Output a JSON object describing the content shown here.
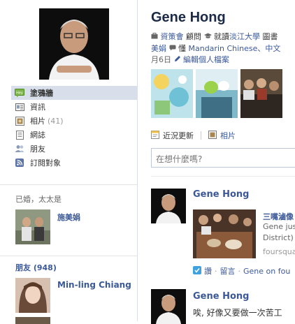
{
  "profile": {
    "name": "Gene Hong",
    "work_org": "資策會",
    "work_role": " 顧問 ",
    "school_prefix": " 就讀",
    "school_name": "淡江大學",
    "school_suffix": " 圖書",
    "spouse_fragment": "美娟",
    "languages_prefix": " 懂 ",
    "languages": "Mandarin Chinese、中文",
    "birthday_fragment": "月6日",
    "edit_profile_label": "編輯個人檔案"
  },
  "nav": {
    "items": [
      {
        "label": "塗鴉牆",
        "icon": "wall-icon",
        "active": true
      },
      {
        "label": "資訊",
        "icon": "info-icon"
      },
      {
        "label": "相片",
        "icon": "photos-icon",
        "count": "(41)"
      },
      {
        "label": "網誌",
        "icon": "notes-icon"
      },
      {
        "label": "朋友",
        "icon": "friends-icon"
      },
      {
        "label": "訂閱對象",
        "icon": "subscriptions-icon"
      }
    ]
  },
  "relationship": {
    "label": "已婚，太太是",
    "partner_name": "施美娟"
  },
  "friends": {
    "title": "朋友 (948)",
    "first_friend": "Min-ling Chiang"
  },
  "publisher": {
    "status_tab": "近況更新",
    "photo_tab": "相片",
    "placeholder": "在想什麼嗎?"
  },
  "feed": {
    "story1": {
      "author": "Gene Hong",
      "attachment_title": "三嘴滷像",
      "attachment_line1": "Gene jus",
      "attachment_line2": "District)",
      "attachment_source": "foursqua",
      "meta_like": "讚",
      "meta_dot1": " · ",
      "meta_comment": "留言",
      "meta_dot2": " · ",
      "meta_via": "Gene on fou"
    },
    "story2": {
      "author": "Gene Hong",
      "text": "唉, 好像又要做一次苦工"
    }
  },
  "colors": {
    "link": "#3b5998",
    "active_nav": "#d8dfea",
    "name_heading": "#1c2a47"
  }
}
